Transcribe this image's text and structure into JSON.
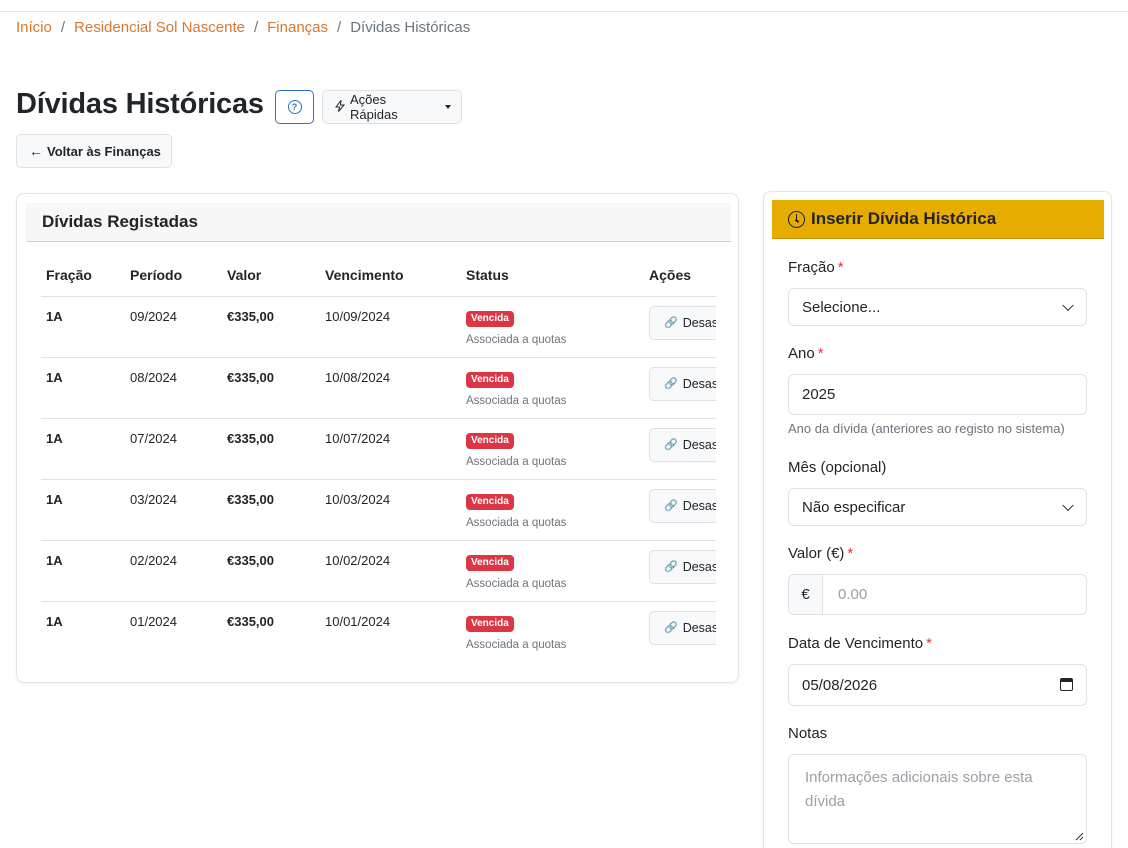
{
  "breadcrumb": {
    "items": [
      "Início",
      "Residencial Sol Nascente",
      "Finanças"
    ],
    "separator": "/",
    "current": "Dívidas Históricas"
  },
  "header": {
    "title": "Dívidas Históricas",
    "help_icon_text": "?",
    "quick_actions_label": "Ações Rápidas",
    "back_label": "Voltar às Finanças"
  },
  "debts_card": {
    "title": "Dívidas Registadas",
    "columns": [
      "Fração",
      "Período",
      "Valor",
      "Vencimento",
      "Status",
      "Ações"
    ],
    "rows": [
      {
        "fracao": "1A",
        "periodo": "09/2024",
        "valor": "€335,00",
        "vencimento": "10/09/2024",
        "status": "Vencida",
        "status_note": "Associada a quotas",
        "action": "Desassociar"
      },
      {
        "fracao": "1A",
        "periodo": "08/2024",
        "valor": "€335,00",
        "vencimento": "10/08/2024",
        "status": "Vencida",
        "status_note": "Associada a quotas",
        "action": "Desassociar"
      },
      {
        "fracao": "1A",
        "periodo": "07/2024",
        "valor": "€335,00",
        "vencimento": "10/07/2024",
        "status": "Vencida",
        "status_note": "Associada a quotas",
        "action": "Desassociar"
      },
      {
        "fracao": "1A",
        "periodo": "03/2024",
        "valor": "€335,00",
        "vencimento": "10/03/2024",
        "status": "Vencida",
        "status_note": "Associada a quotas",
        "action": "Desassociar"
      },
      {
        "fracao": "1A",
        "periodo": "02/2024",
        "valor": "€335,00",
        "vencimento": "10/02/2024",
        "status": "Vencida",
        "status_note": "Associada a quotas",
        "action": "Desassociar"
      },
      {
        "fracao": "1A",
        "periodo": "01/2024",
        "valor": "€335,00",
        "vencimento": "10/01/2024",
        "status": "Vencida",
        "status_note": "Associada a quotas",
        "action": "Desassociar"
      }
    ]
  },
  "insert_form": {
    "title": "Inserir Dívida Histórica",
    "fracao": {
      "label": "Fração",
      "value": "Selecione..."
    },
    "ano": {
      "label": "Ano",
      "value": "2025",
      "help": "Ano da dívida (anteriores ao registo no sistema)"
    },
    "mes": {
      "label": "Mês (opcional)",
      "value": "Não especificar"
    },
    "valor": {
      "label": "Valor (€)",
      "prefix": "€",
      "placeholder": "0.00"
    },
    "vencimento": {
      "label": "Data de Vencimento",
      "value": "05/08/2026"
    },
    "notas": {
      "label": "Notas",
      "placeholder": "Informações adicionais sobre esta dívida"
    },
    "required_mark": "*"
  },
  "colors": {
    "link": "#d9782d",
    "danger": "#dc3545",
    "form_header": "#e6ac00",
    "primary": "#2f6fd1"
  }
}
